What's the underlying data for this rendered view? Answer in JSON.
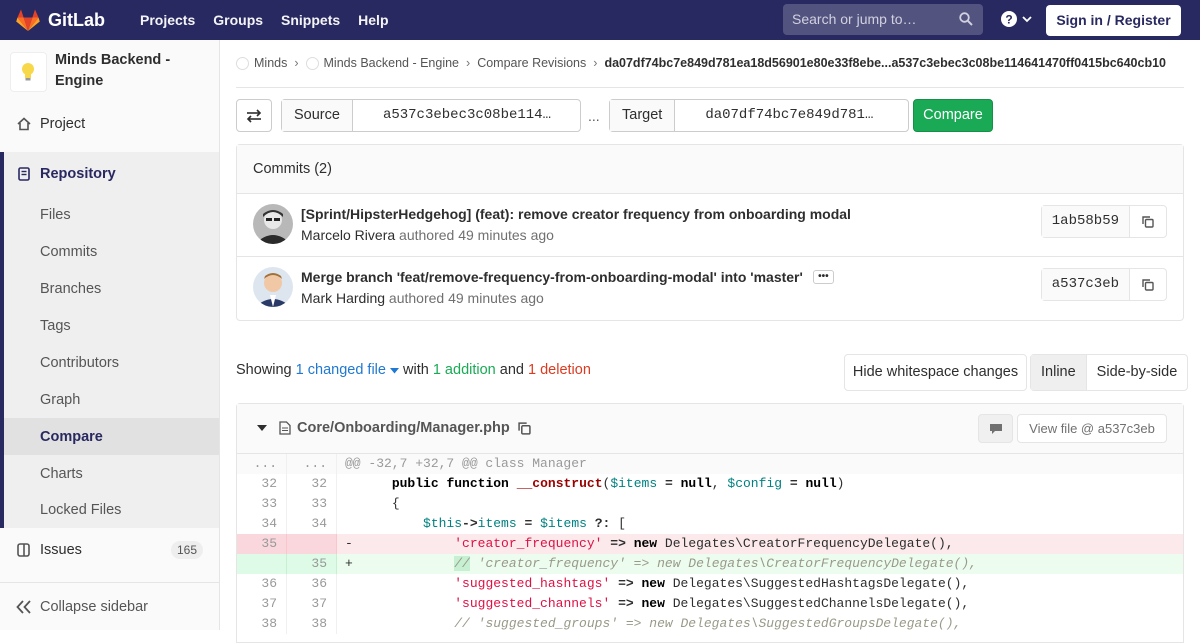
{
  "topbar": {
    "brand": "GitLab",
    "nav": [
      "Projects",
      "Groups",
      "Snippets",
      "Help"
    ],
    "search_placeholder": "Search or jump to…",
    "signin": "Sign in / Register"
  },
  "sidebar": {
    "project_name": "Minds Backend - Engine",
    "project": "Project",
    "repository": "Repository",
    "items": [
      "Files",
      "Commits",
      "Branches",
      "Tags",
      "Contributors",
      "Graph",
      "Compare",
      "Charts",
      "Locked Files"
    ],
    "issues": "Issues",
    "issues_count": "165",
    "collapse": "Collapse sidebar"
  },
  "breadcrumb": {
    "items": [
      "Minds",
      "Minds Backend - Engine",
      "Compare Revisions"
    ],
    "current": "da07df74bc7e849d781ea18d56901e80e33f8ebe...a537c3ebec3c08be114641470ff0415bc640cb10"
  },
  "compare": {
    "source_label": "Source",
    "source_value": "a537c3ebec3c08be114…",
    "dots": "...",
    "target_label": "Target",
    "target_value": "da07df74bc7e849d781…",
    "button": "Compare"
  },
  "commits": {
    "header": "Commits (2)",
    "list": [
      {
        "title": "[Sprint/HipsterHedgehog] (feat): remove creator frequency from onboarding modal",
        "author": "Marcelo Rivera",
        "authored": "authored",
        "time": "49 minutes ago",
        "sha": "1ab58b59"
      },
      {
        "title": "Merge branch 'feat/remove-frequency-from-onboarding-modal' into 'master'",
        "author": "Mark Harding",
        "authored": "authored",
        "time": "49 minutes ago",
        "sha": "a537c3eb"
      }
    ]
  },
  "summary": {
    "showing": "Showing",
    "changed": "1 changed file",
    "with": "with",
    "additions": "1 addition",
    "and": "and",
    "deletions": "1 deletion",
    "whitespace": "Hide whitespace changes",
    "inline": "Inline",
    "side_by_side": "Side-by-side"
  },
  "diff": {
    "path": "Core/Onboarding/Manager.php",
    "view_file": "View file @ a537c3eb",
    "hunk": "@@ -32,7 +32,7 @@ class Manager",
    "hunk_old": "...",
    "hunk_new": "...",
    "lines": [
      {
        "old": "32",
        "new": "32",
        "sign": " "
      },
      {
        "old": "33",
        "new": "33",
        "sign": " "
      },
      {
        "old": "34",
        "new": "34",
        "sign": " "
      },
      {
        "old": "35",
        "new": "",
        "sign": "-"
      },
      {
        "old": "",
        "new": "35",
        "sign": "+"
      },
      {
        "old": "36",
        "new": "36",
        "sign": " "
      },
      {
        "old": "37",
        "new": "37",
        "sign": " "
      },
      {
        "old": "38",
        "new": "38",
        "sign": " "
      }
    ],
    "code": {
      "l32_kw1": "public",
      "l32_kw2": "function",
      "l32_fn": "__construct",
      "l32_v1": "$items",
      "l32_null1": "null",
      "l32_v2": "$config",
      "l32_null2": "null",
      "l33": "{",
      "l34_v1": "$this",
      "l34_arrow": "->",
      "l34_prop": "items",
      "l34_v2": "$items",
      "l34_op": "?:",
      "l35_str": "'creator_frequency'",
      "l35_kw": "new",
      "l35_rest": "Delegates\\CreatorFrequencyDelegate(),",
      "l35n_hl": "//",
      "l35n_rest": "'creator_frequency' => new Delegates\\CreatorFrequencyDelegate(),",
      "l36_str": "'suggested_hashtags'",
      "l36_kw": "new",
      "l36_rest": "Delegates\\SuggestedHashtagsDelegate(),",
      "l37_str": "'suggested_channels'",
      "l37_kw": "new",
      "l37_rest": "Delegates\\SuggestedChannelsDelegate(),",
      "l38": "// 'suggested_groups' => new Delegates\\SuggestedGroupsDelegate(),"
    }
  }
}
